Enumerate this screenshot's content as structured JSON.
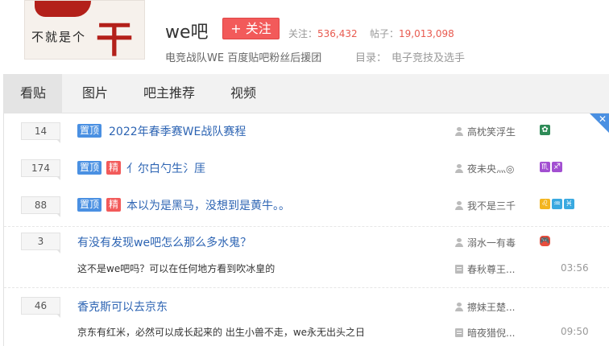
{
  "header": {
    "logo_text": "不就是个",
    "logo_char": "干",
    "forum_name": "we吧",
    "follow_label": "+ 关注",
    "follow_stat_label": "关注：",
    "follow_count": "536,432",
    "post_stat_label": "帖子：",
    "post_count": "19,013,098",
    "slogan": "电竞战队WE 百度贴吧粉丝后援团",
    "directory_label": "目录：",
    "directory_value": "电子竞技及选手"
  },
  "tabs": [
    "看贴",
    "图片",
    "吧主推荐",
    "视频"
  ],
  "active_tab": "看贴",
  "corner_close": "✕",
  "threads": [
    {
      "replies": "14",
      "badges": [
        "置顶"
      ],
      "title": "2022年春季赛WE战队赛程",
      "author": "高枕笑浮生",
      "medals": [
        "✿"
      ]
    },
    {
      "replies": "174",
      "badges": [
        "置顶",
        "精"
      ],
      "title": "亻尔白勺生氵厓",
      "author": "夜未央灬◎",
      "medals": [
        "♏",
        "♐"
      ]
    },
    {
      "replies": "88",
      "badges": [
        "置顶",
        "精"
      ],
      "title": "本以为是黑马，没想到是黄牛。。",
      "author": "我不是三千",
      "medals": [
        "♌",
        "♒",
        "♓"
      ]
    },
    {
      "replies": "3",
      "badges": [],
      "title": "有没有发现we吧怎么那么多水鬼？",
      "abstract": "这不是we吧吗？可以在任何地方看到吹冰皇的",
      "author": "溺水一有毒",
      "last_reply": "春秋尊王...",
      "time": "03:56",
      "medals": [
        "🎮"
      ]
    },
    {
      "replies": "46",
      "badges": [],
      "title": "香克斯可以去京东",
      "abstract": "京东有红米，必然可以成长起来的 出生小兽不走，we永无出头之日",
      "author": "擦妹王楚...",
      "last_reply": "暗夜猎倪...",
      "time": "09:50",
      "medals": []
    }
  ],
  "colors": {
    "accent_blue": "#2d64b3",
    "badge_blue": "#4a90e2",
    "badge_red": "#f25a5a",
    "count_red": "#e85a4f"
  }
}
